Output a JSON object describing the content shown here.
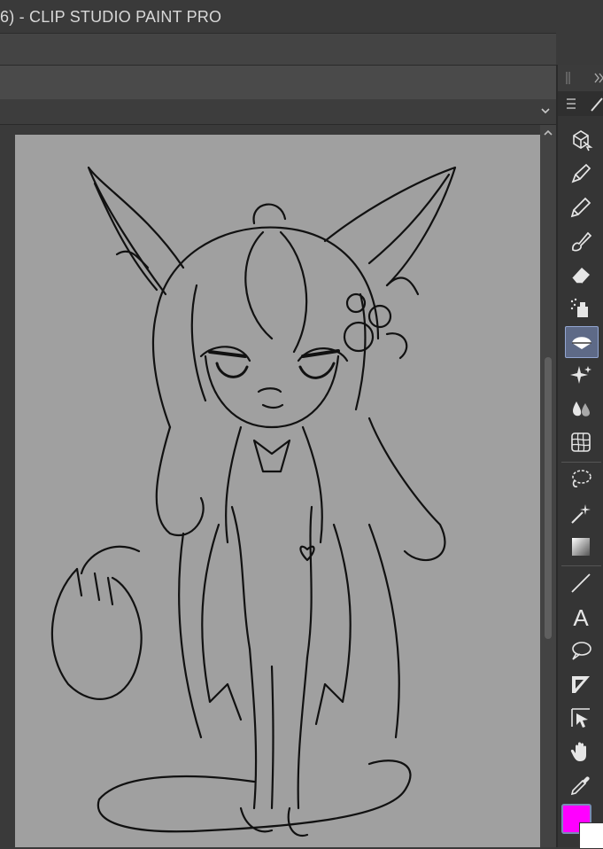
{
  "window": {
    "title": "6)  - CLIP STUDIO PAINT PRO"
  },
  "colors": {
    "main": "#ff00ff",
    "sub": "#ffffff",
    "canvas": "#a0a0a0",
    "selected_tool": "#5e6a87"
  },
  "canvas": {
    "content": "line-art-character"
  },
  "tools": [
    {
      "name": "operation-icon"
    },
    {
      "name": "pen-icon"
    },
    {
      "name": "pencil-icon"
    },
    {
      "name": "brush-icon"
    },
    {
      "name": "eraser-icon"
    },
    {
      "name": "decoration-icon"
    },
    {
      "name": "fill-icon",
      "selected": true
    },
    {
      "name": "sparkle-icon"
    },
    {
      "name": "blend-icon"
    },
    {
      "name": "mesh-transform-icon"
    },
    {
      "name": "lasso-icon"
    },
    {
      "name": "magic-wand-icon"
    },
    {
      "name": "gradient-icon"
    },
    {
      "name": "line-icon"
    },
    {
      "name": "text-icon",
      "glyph": "A"
    },
    {
      "name": "balloon-icon"
    },
    {
      "name": "frame-border-icon"
    },
    {
      "name": "ruler-icon"
    },
    {
      "name": "hand-icon"
    },
    {
      "name": "eyedropper-icon"
    }
  ]
}
